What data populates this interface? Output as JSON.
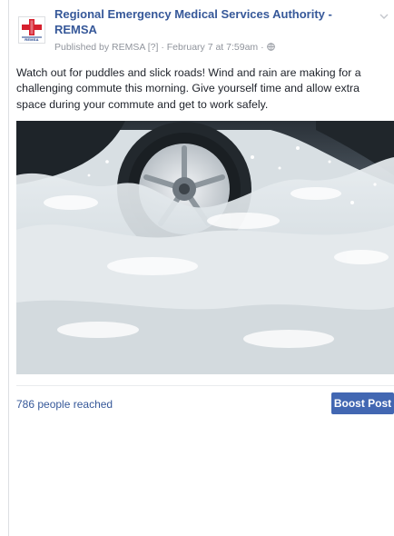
{
  "post": {
    "page_name": "Regional Emergency Medical Services Authority - REMSA",
    "avatar_text": "REMSA",
    "meta": {
      "published_by": "Published by REMSA",
      "help_marker": "[?]",
      "separator": "·",
      "timestamp": "February 7 at 7:59am",
      "audience_icon": "globe-icon"
    },
    "text": "Watch out for puddles and slick roads! Wind and rain are making for a challenging commute this morning. Give yourself time and allow extra space during your commute and get to work safely.",
    "photo_icon": "car-wheel-splashing-water-photo",
    "menu_icon": "chevron-down-icon"
  },
  "footer": {
    "reach": "786 people reached",
    "boost_label": "Boost Post"
  },
  "colors": {
    "link": "#365899",
    "button": "#4267b2",
    "meta": "#90949c",
    "text": "#1d2129",
    "avatar_cross": "#d6202e"
  }
}
